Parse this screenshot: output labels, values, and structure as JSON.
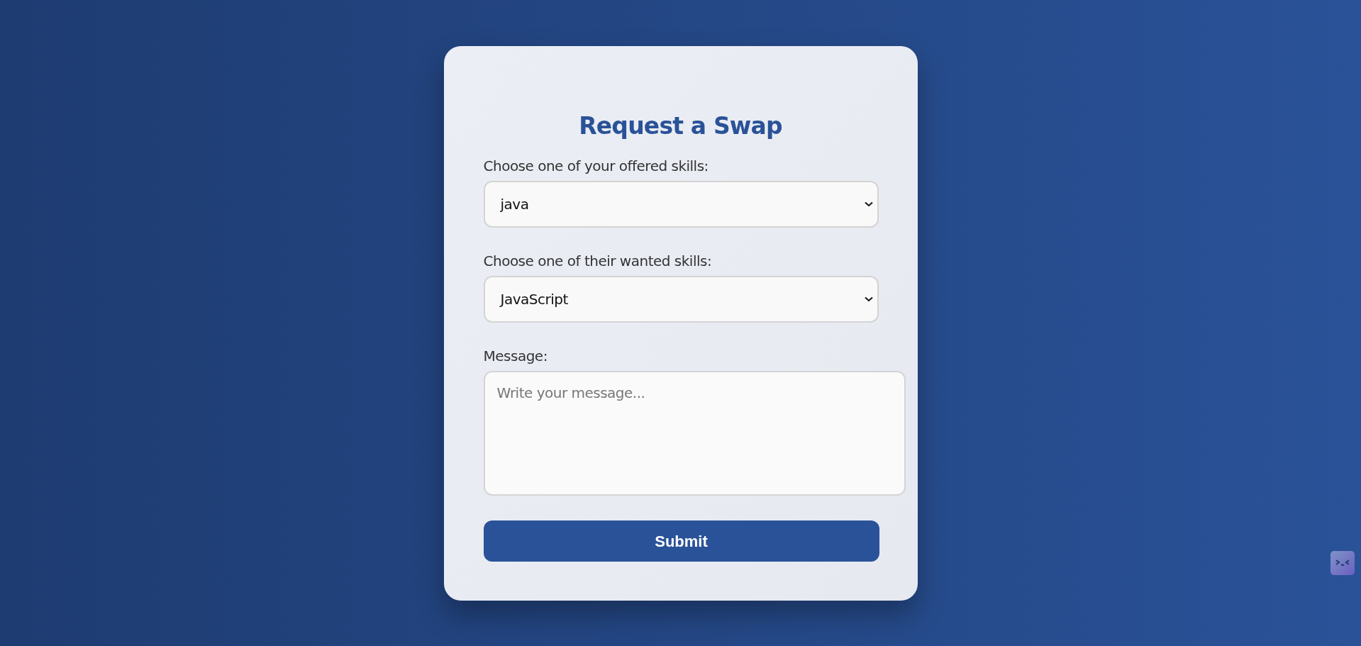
{
  "form": {
    "title": "Request a Swap",
    "fields": [
      {
        "kind": "select",
        "label": "Choose one of your offered skills:",
        "value": "java"
      },
      {
        "kind": "select",
        "label": "Choose one of their wanted skills:",
        "value": "JavaScript"
      },
      {
        "kind": "textarea",
        "label": "Message:",
        "placeholder": "Write your message..."
      }
    ],
    "submit": "Submit"
  }
}
